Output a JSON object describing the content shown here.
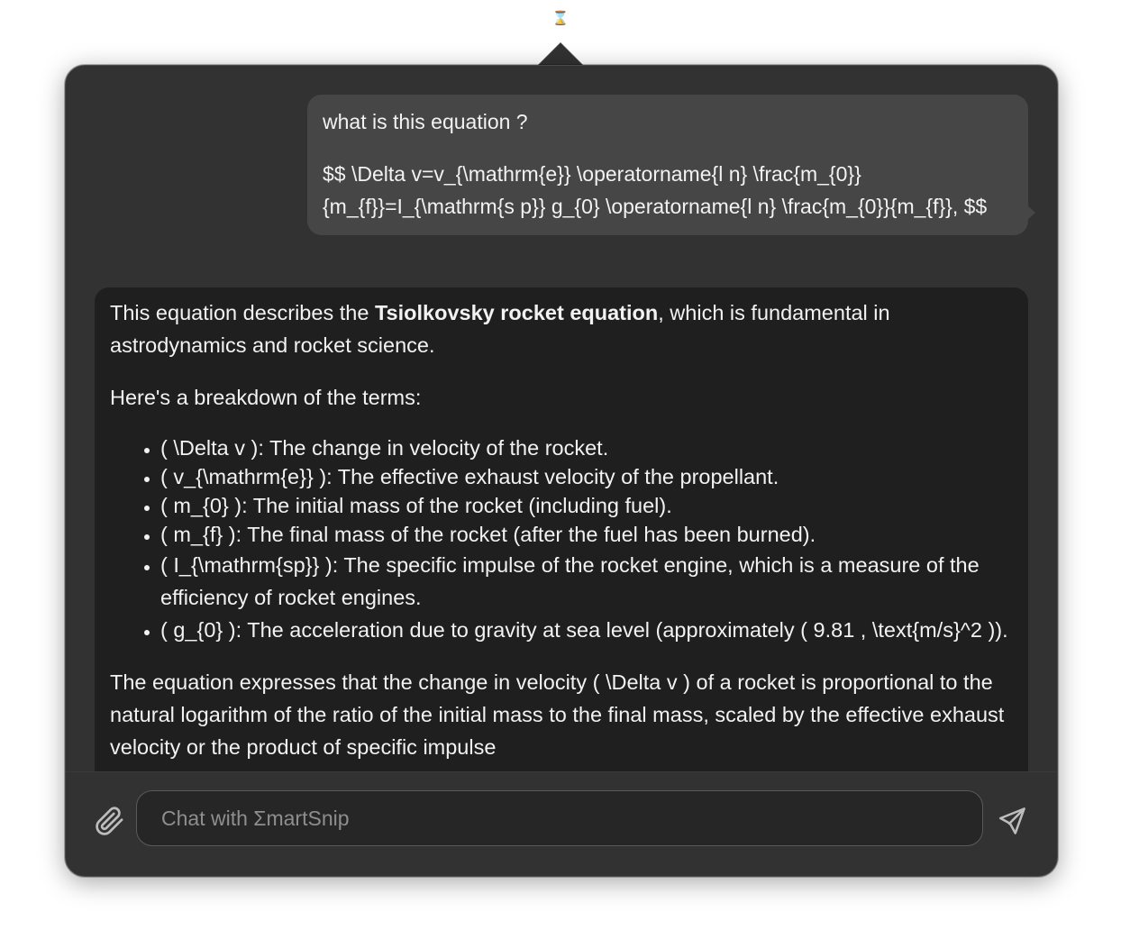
{
  "menubar": {
    "icon": "smartsnip-menubar-icon",
    "glyph": "⌛"
  },
  "chat": {
    "user_message": {
      "line1": "what is this equation ?",
      "line2": "$$ \\Delta v=v_{\\mathrm{e}} \\operatorname{l n} \\frac{m_{0}}{m_{f}}=I_{\\mathrm{s p}} g_{0} \\operatorname{l n} \\frac{m_{0}}{m_{f}}, $$"
    },
    "assistant_message": {
      "intro_before": "This equation describes the ",
      "intro_bold": "Tsiolkovsky rocket equation",
      "intro_after": ", which is fundamental in astrodynamics and rocket science.",
      "breakdown_heading": "Here's a breakdown of the terms:",
      "terms": [
        "( \\Delta v ): The change in velocity of the rocket.",
        "( v_{\\mathrm{e}} ): The effective exhaust velocity of the propellant.",
        "( m_{0} ): The initial mass of the rocket (including fuel).",
        "( m_{f} ): The final mass of the rocket (after the fuel has been burned).",
        "( I_{\\mathrm{sp}} ): The specific impulse of the rocket engine, which is a measure of the efficiency of rocket engines.",
        "( g_{0} ): The acceleration due to gravity at sea level (approximately ( 9.81 , \\text{m/s}^2 ))."
      ],
      "conclusion": "The equation expresses that the change in velocity ( \\Delta v ) of a rocket is proportional to the natural logarithm of the ratio of the initial mass to the final mass, scaled by the effective exhaust velocity or the product of specific impulse"
    }
  },
  "composer": {
    "placeholder": "Chat with ΣmartSnip",
    "attach_icon": "paperclip-icon",
    "send_icon": "send-icon"
  },
  "colors": {
    "popover_bg": "#323232",
    "user_bubble": "#464646",
    "assistant_bubble": "#1f1f1f",
    "text": "#f2f2f2",
    "placeholder": "#8e8e8e",
    "icon": "#bdbdbd"
  }
}
